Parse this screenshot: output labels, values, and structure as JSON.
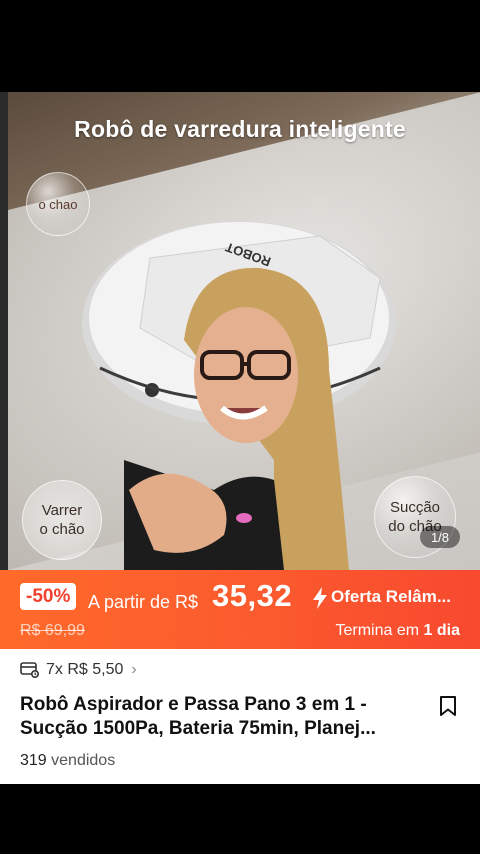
{
  "gallery": {
    "headline": "Robô de varredura inteligente",
    "bubble_top": "o chao",
    "bubble_left": "Varrer\no chão",
    "bubble_right": "Sucção\ndo chão",
    "robot_brand": "ROBOT",
    "counter": "1/8"
  },
  "promo": {
    "discount": "-50%",
    "from_label": "A partir de R$",
    "price": "35,32",
    "flash_label": "Oferta Relâm...",
    "old_price": "R$ 69,99",
    "ends_prefix": "Termina em",
    "ends_value": "1 dia"
  },
  "product": {
    "installment": "7x R$ 5,50",
    "title_line1": "Robô Aspirador e Passa Pano 3 em 1 -",
    "title_line2": "Sucção 1500Pa, Bateria 75min, Planej...",
    "sold_count": "319",
    "sold_label": "vendidos"
  },
  "colors": {
    "promo_start": "#ff6a2a",
    "promo_end": "#f8492f",
    "discount_text": "#f2412c"
  }
}
